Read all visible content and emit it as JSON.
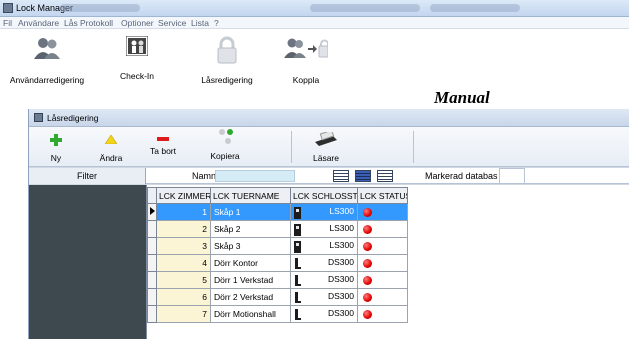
{
  "window": {
    "title": "Lock Manager"
  },
  "menu": [
    "Fil",
    "Användare",
    "Lås",
    "Protokoll",
    "Optioner",
    "Service",
    "Lista",
    "?"
  ],
  "main_toolbar": [
    {
      "label": "Användarredigering",
      "icon": "users-icon"
    },
    {
      "label": "Check-In",
      "icon": "check-in-icon"
    },
    {
      "label": "Låsredigering",
      "icon": "padlock-icon"
    },
    {
      "label": "Koppla",
      "icon": "users-link-lock-icon"
    }
  ],
  "mode_label": "Manual",
  "child_window": {
    "title": "Låsredigering",
    "toolbar": [
      {
        "label": "Ny",
        "icon": "plus-icon"
      },
      {
        "label": "Ändra",
        "icon": "triangle-icon"
      },
      {
        "label": "Ta bort",
        "icon": "minus-icon"
      },
      {
        "label": "Kopiera",
        "icon": "copy-icon"
      },
      {
        "label": "Läsare",
        "icon": "card-reader-icon"
      }
    ],
    "filter_label": "Filter",
    "name_label": "Namn",
    "name_value": "",
    "marked_db_label": "Markerad databas",
    "marked_db_value": ""
  },
  "table": {
    "columns": [
      "LCK ZIMMERN",
      "LCK TUERNAME",
      "LCK SCHLOSSTY",
      "LCK STATUS"
    ],
    "rows": [
      {
        "zimmer": "1",
        "name": "Skåp 1",
        "type": "LS300",
        "lock": "ls",
        "status": "red"
      },
      {
        "zimmer": "2",
        "name": "Skåp 2",
        "type": "LS300",
        "lock": "ls",
        "status": "red"
      },
      {
        "zimmer": "3",
        "name": "Skåp 3",
        "type": "LS300",
        "lock": "ls",
        "status": "red"
      },
      {
        "zimmer": "4",
        "name": "Dörr Kontor",
        "type": "DS300",
        "lock": "ds",
        "status": "red"
      },
      {
        "zimmer": "5",
        "name": "Dörr 1 Verkstad",
        "type": "DS300",
        "lock": "ds",
        "status": "red"
      },
      {
        "zimmer": "6",
        "name": "Dörr 2 Verkstad",
        "type": "DS300",
        "lock": "ds",
        "status": "red"
      },
      {
        "zimmer": "7",
        "name": "Dörr Motionshall",
        "type": "DS300",
        "lock": "ds",
        "status": "red"
      }
    ],
    "selected_row": 0
  },
  "colors": {
    "selection": "#3399ff",
    "status_red": "#e10000",
    "left_panel": "#3e484f",
    "name_input": "#d5ecf7"
  }
}
